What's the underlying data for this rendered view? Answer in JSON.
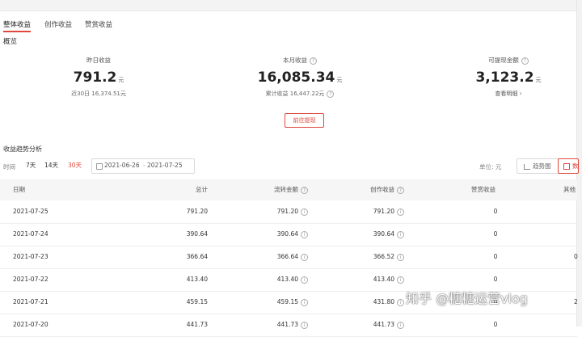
{
  "tabs": [
    {
      "label": "整体收益",
      "active": true
    },
    {
      "label": "创作收益",
      "active": false
    },
    {
      "label": "赞赏收益",
      "active": false
    }
  ],
  "overview_title": "概览",
  "stats": [
    {
      "label": "昨日收益",
      "value": "791.2",
      "unit": "元",
      "sub": "近30日 16,374.51元"
    },
    {
      "label": "本月收益",
      "value": "16,085.34",
      "unit": "元",
      "sub": "累计收益 16,447.22元"
    },
    {
      "label": "可提现金额",
      "value": "3,123.2",
      "unit": "元",
      "sub": "查看明细"
    }
  ],
  "withdraw_button": "前往提现",
  "trend": {
    "title": "收益趋势分析",
    "time_label": "时间",
    "ranges": [
      "7天",
      "14天",
      "30天"
    ],
    "active_range": "30天",
    "date_start": "2021-06-26",
    "date_sep": "-",
    "date_end": "2021-07-25",
    "unit_label": "单位: 元",
    "view_chart": "趋势图",
    "view_table": "数"
  },
  "table": {
    "headers": [
      "日期",
      "总计",
      "流转金额",
      "创作收益",
      "赞赏收益",
      "其他"
    ],
    "rows": [
      {
        "date": "2021-07-25",
        "total": "791.20",
        "flow": "791.20",
        "create": "791.20",
        "reward": "0",
        "other": ""
      },
      {
        "date": "2021-07-24",
        "total": "390.64",
        "flow": "390.64",
        "create": "390.64",
        "reward": "0",
        "other": ""
      },
      {
        "date": "2021-07-23",
        "total": "366.64",
        "flow": "366.64",
        "create": "366.52",
        "reward": "0",
        "other": "0"
      },
      {
        "date": "2021-07-22",
        "total": "413.40",
        "flow": "413.40",
        "create": "413.40",
        "reward": "0",
        "other": ""
      },
      {
        "date": "2021-07-21",
        "total": "459.15",
        "flow": "459.15",
        "create": "431.80",
        "reward": "0",
        "other": "2"
      },
      {
        "date": "2021-07-20",
        "total": "441.73",
        "flow": "441.73",
        "create": "441.73",
        "reward": "0",
        "other": ""
      }
    ]
  },
  "watermark": "知乎 @糖糖运营vlog",
  "colors": {
    "accent": "#e0473a",
    "header_bg": "#f6f6f6",
    "border": "#eeeeee"
  }
}
